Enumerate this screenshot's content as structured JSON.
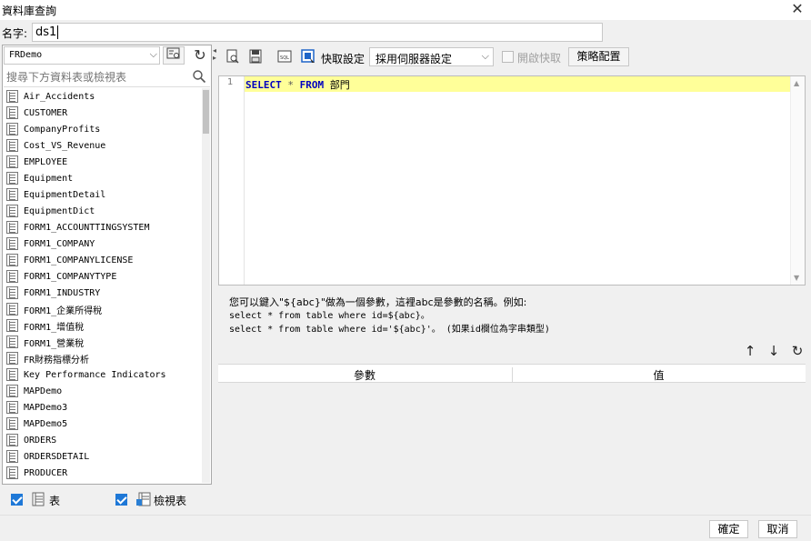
{
  "window": {
    "title": "資料庫查詢",
    "close_glyph": "✕"
  },
  "name_row": {
    "label": "名字:",
    "value": "ds1"
  },
  "left_panel": {
    "db_select": "FRDemo",
    "search_placeholder": "搜尋下方資料表或檢視表",
    "tables": [
      "Air_Accidents",
      "CUSTOMER",
      "CompanyProfits",
      "Cost_VS_Revenue",
      "EMPLOYEE",
      "Equipment",
      "EquipmentDetail",
      "EquipmentDict",
      "FORM1_ACCOUNTTINGSYSTEM",
      "FORM1_COMPANY",
      "FORM1_COMPANYLICENSE",
      "FORM1_COMPANYTYPE",
      "FORM1_INDUSTRY",
      "FORM1_企業所得稅",
      "FORM1_增值稅",
      "FORM1_營業稅",
      "FR財務指標分析",
      "Key Performance Indicators",
      "MAPDemo",
      "MAPDemo3",
      "MAPDemo5",
      "ORDERS",
      "ORDERSDETAIL",
      "PRODUCER"
    ],
    "footer": {
      "tables_label": "表",
      "views_label": "檢視表"
    }
  },
  "toolbar": {
    "cache_setting_label": "快取設定",
    "cache_select": "採用伺服器設定",
    "cache_toggle_label": "開啟快取",
    "strategy_button": "策略配置"
  },
  "editor": {
    "line_number": "1",
    "sql": {
      "kw1": "SELECT",
      "star": "*",
      "kw2": "FROM",
      "table": "部門"
    }
  },
  "hint": {
    "line1": "您可以鍵入\"${abc}\"做為一個參數，這裡abc是參數的名稱。例如:",
    "line2": "select * from table where id=${abc}。",
    "line3": "select * from table where id='${abc}'。 (如果id欄位為字串類型)"
  },
  "param_table": {
    "col_param": "參數",
    "col_value": "值"
  },
  "buttons": {
    "ok": "確定",
    "cancel": "取消"
  },
  "colors": {
    "accent": "#1e78d7",
    "keyword": "#0000c0",
    "line_highlight": "#ffff99"
  }
}
